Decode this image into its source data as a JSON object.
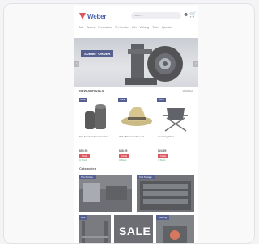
{
  "header": {
    "logo_text": "Weber",
    "search_placeholder": "Search",
    "icons": [
      "user-icon",
      "cart-icon"
    ]
  },
  "nav": {
    "items": [
      "Sale",
      "Brakes",
      "Pneumatics",
      "Tire Service",
      "Lifts",
      "Welding",
      "Tools",
      "Specials"
    ]
  },
  "hero": {
    "badge": "SUBMIT ORDER"
  },
  "featured": {
    "title": "NEW ARRIVALS",
    "link": "VIEW ALL",
    "products": [
      {
        "tag": "SALE",
        "name": "Tire Stacked Stand Holder",
        "price": "$59.95",
        "sale": "SALE",
        "stock": "In Stock"
      },
      {
        "tag": "SALE",
        "name": "Wide Brimmed Sun Hat",
        "price": "$38.95",
        "sale": "SALE",
        "stock": "In Stock"
      },
      {
        "tag": "SALE",
        "name": "Camping Chair",
        "price": "$24.95",
        "sale": "SALE",
        "stock": "In Stock"
      }
    ]
  },
  "categories": {
    "title": "Categories",
    "items": [
      {
        "label": "Tire Service"
      },
      {
        "label": "Tool Storage"
      },
      {
        "label": "Lifts"
      },
      {
        "label": "SALE"
      },
      {
        "label": "Welding"
      }
    ]
  },
  "colors": {
    "brand_navy": "#1c2b6b",
    "brand_red": "#d21f2b",
    "logo_blue": "#0d2a8c"
  }
}
